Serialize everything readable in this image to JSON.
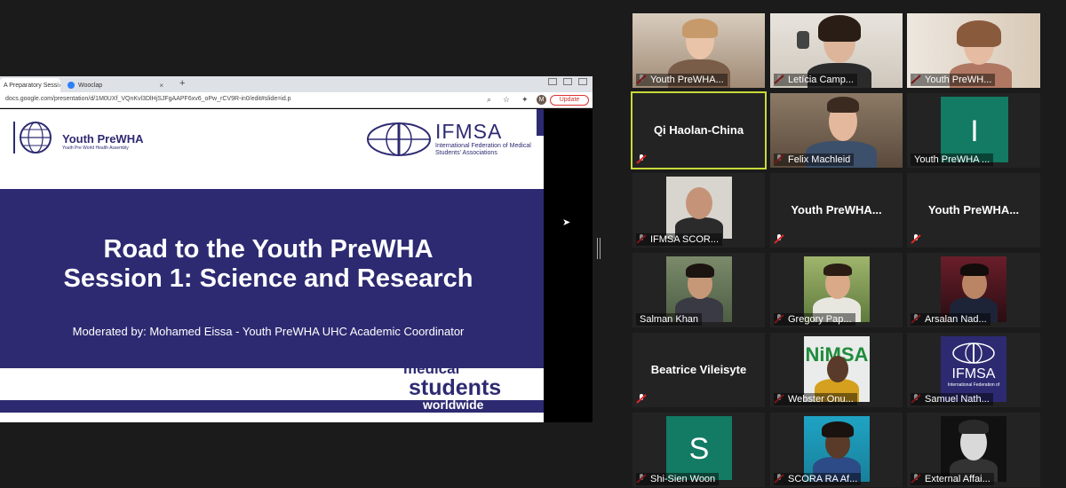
{
  "browser": {
    "tabs": [
      {
        "title": "A Preparatory Sessi",
        "active": true
      },
      {
        "title": "Wooclap",
        "active": false
      }
    ],
    "url": "docs.google.com/presentation/d/1M0UXf_VQnKvl3DlHjSJFgAAPF6xv6_oPw_rCV9R-in0/edit#slide=id.p",
    "profile_initial": "M",
    "update_label": "Update",
    "new_tab": "+",
    "close_glyph": "×"
  },
  "slide": {
    "logo_left_name": "Youth PreWHA",
    "logo_left_sub": "Youth Pre World Health Assembly",
    "logo_right_name": "IFMSA",
    "logo_right_sub": "International Federation of Medical Students' Associations",
    "title_line1": "Road to the Youth PreWHA",
    "title_line2": "Session 1: Science and Research",
    "moderator": "Moderated by: Mohamed Eissa - Youth PreWHA UHC Academic Coordinator",
    "tagline_1": "medical",
    "tagline_2": "students",
    "tagline_3": "worldwide"
  },
  "participants": [
    {
      "name": "Youth PreWHA...",
      "muted": true
    },
    {
      "name": "Letícia Camp...",
      "muted": true
    },
    {
      "name": "Youth PreWH...",
      "muted": true
    },
    {
      "name": "Qi Haolan-China",
      "muted": true,
      "active_speaker": true
    },
    {
      "name": "Felix Machleid",
      "muted": true
    },
    {
      "name": "Youth PreWHA ...",
      "muted": false,
      "avatar_letter": "I"
    },
    {
      "name": "IFMSA SCOR...",
      "muted": true
    },
    {
      "name": "Youth  PreWHA...",
      "muted": true
    },
    {
      "name": "Youth  PreWHA...",
      "muted": true
    },
    {
      "name": "Salman Khan",
      "muted": false
    },
    {
      "name": "Gregory Pap...",
      "muted": true
    },
    {
      "name": "Arsalan Nad...",
      "muted": true
    },
    {
      "name": "Beatrice Vileisyte",
      "muted": true
    },
    {
      "name": "Webster Onu...",
      "muted": true
    },
    {
      "name": "Samuel Nath...",
      "muted": true
    },
    {
      "name": "Shi-Sien Woon",
      "muted": true,
      "avatar_letter": "S"
    },
    {
      "name": "SCORA RA Af...",
      "muted": true
    },
    {
      "name": "External Affai...",
      "muted": true
    }
  ],
  "tile_badges": {
    "ifmsa_logo_text": "IFMSA",
    "ifmsa_logo_sub": "International Federation of",
    "nimsa_text": "NiMSA"
  },
  "colors": {
    "slide_navy": "#2d2a72",
    "speaker_highlight": "#c8d93a",
    "avatar_teal": "#137a63",
    "mute_red": "#e02828"
  },
  "icons": {
    "muted": "microphone-muted-icon",
    "cursor": "mouse-pointer-icon"
  }
}
